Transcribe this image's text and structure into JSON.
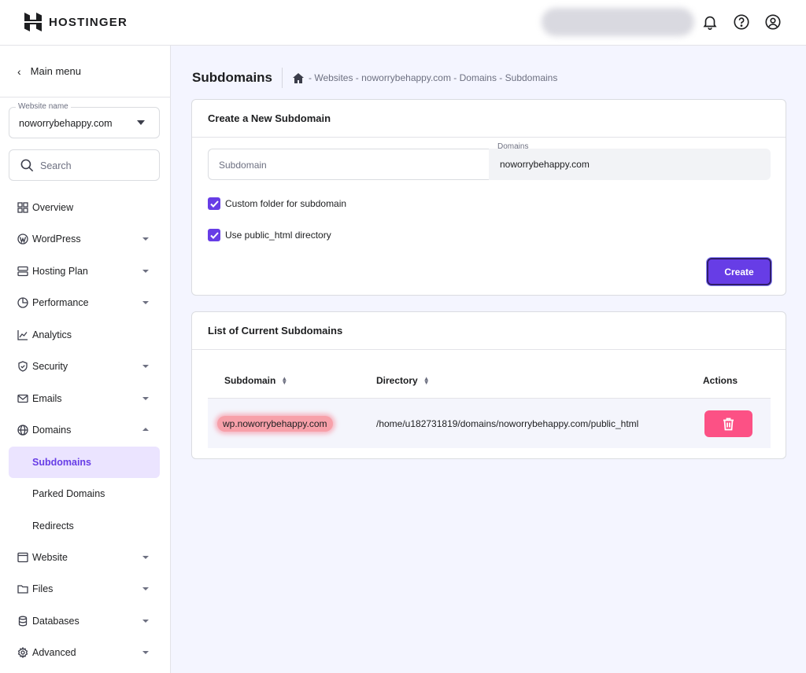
{
  "brand": {
    "name": "HOSTINGER"
  },
  "header": {
    "icons": [
      "bell-icon",
      "help-icon",
      "account-icon"
    ]
  },
  "sidebar": {
    "main_menu_label": "Main menu",
    "website_select": {
      "label": "Website name",
      "value": "noworrybehappy.com"
    },
    "search_placeholder": "Search",
    "items": [
      {
        "label": "Overview",
        "icon": "overview-icon",
        "expandable": false
      },
      {
        "label": "WordPress",
        "icon": "wordpress-icon",
        "expandable": true
      },
      {
        "label": "Hosting Plan",
        "icon": "server-icon",
        "expandable": true
      },
      {
        "label": "Performance",
        "icon": "pie-chart-icon",
        "expandable": true
      },
      {
        "label": "Analytics",
        "icon": "analytics-icon",
        "expandable": false
      },
      {
        "label": "Security",
        "icon": "shield-icon",
        "expandable": true
      },
      {
        "label": "Emails",
        "icon": "mail-icon",
        "expandable": true
      },
      {
        "label": "Domains",
        "icon": "globe-icon",
        "expandable": true,
        "expanded": true
      },
      {
        "label": "Subdomains",
        "active": true
      },
      {
        "label": "Parked Domains"
      },
      {
        "label": "Redirects"
      },
      {
        "label": "Website",
        "icon": "browser-icon",
        "expandable": true
      },
      {
        "label": "Files",
        "icon": "folder-icon",
        "expandable": true
      },
      {
        "label": "Databases",
        "icon": "database-icon",
        "expandable": true
      },
      {
        "label": "Advanced",
        "icon": "gear-icon",
        "expandable": true
      }
    ]
  },
  "page": {
    "title": "Subdomains",
    "breadcrumb": "- Websites - noworrybehappy.com - Domains - Subdomains"
  },
  "create_card": {
    "title": "Create a New Subdomain",
    "subdomain_placeholder": "Subdomain",
    "domains_label": "Domains",
    "domains_value": "noworrybehappy.com",
    "checkbox_custom_folder": {
      "label": "Custom folder for subdomain",
      "checked": true
    },
    "checkbox_public_html": {
      "label": "Use public_html directory",
      "checked": true
    },
    "create_button": "Create"
  },
  "list_card": {
    "title": "List of Current Subdomains",
    "columns": {
      "subdomain": "Subdomain",
      "directory": "Directory",
      "actions": "Actions"
    },
    "rows": [
      {
        "subdomain": "wp.noworrybehappy.com",
        "directory": "/home/u182731819/domains/noworrybehappy.com/public_html"
      }
    ]
  },
  "colors": {
    "accent": "#673de6",
    "delete": "#fc5185",
    "highlight": "#f7a0a9"
  }
}
